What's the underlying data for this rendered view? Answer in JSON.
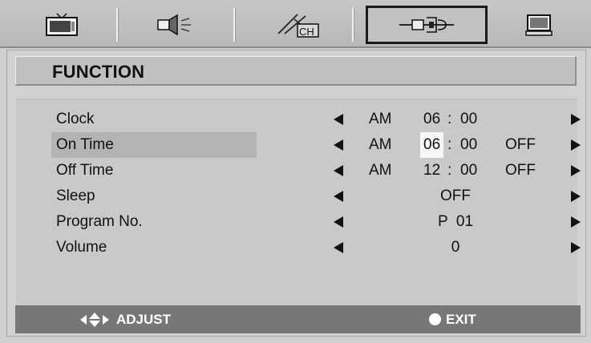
{
  "tabs": [
    {
      "icon": "tv-picture-icon",
      "selected": false
    },
    {
      "icon": "sound-speaker-icon",
      "selected": false
    },
    {
      "icon": "channel-antenna-icon",
      "selected": false,
      "icon_text": "CH"
    },
    {
      "icon": "function-tools-icon",
      "selected": true
    },
    {
      "icon": "pc-monitor-icon",
      "selected": false
    }
  ],
  "menu": {
    "title": "FUNCTION",
    "rows": [
      {
        "label": "Clock",
        "ampm": "AM",
        "hour": "06",
        "colon": ":",
        "minute": "00",
        "state": ""
      },
      {
        "label": "On Time",
        "ampm": "AM",
        "hour": "06",
        "colon": ":",
        "minute": "00",
        "state": "OFF"
      },
      {
        "label": "Off Time",
        "ampm": "AM",
        "hour": "12",
        "colon": ":",
        "minute": "00",
        "state": "OFF"
      },
      {
        "label": "Sleep",
        "value": "OFF"
      },
      {
        "label": "Program No.",
        "value": "P  01"
      },
      {
        "label": "Volume",
        "value": "0"
      }
    ]
  },
  "footer": {
    "adjust_label": "ADJUST",
    "exit_label": "EXIT"
  },
  "colors": {
    "background": "#cfcfcf",
    "footer_bar": "#777777",
    "highlight": "#b3b3b3",
    "selected_tab_border": "#1a1a1a"
  }
}
